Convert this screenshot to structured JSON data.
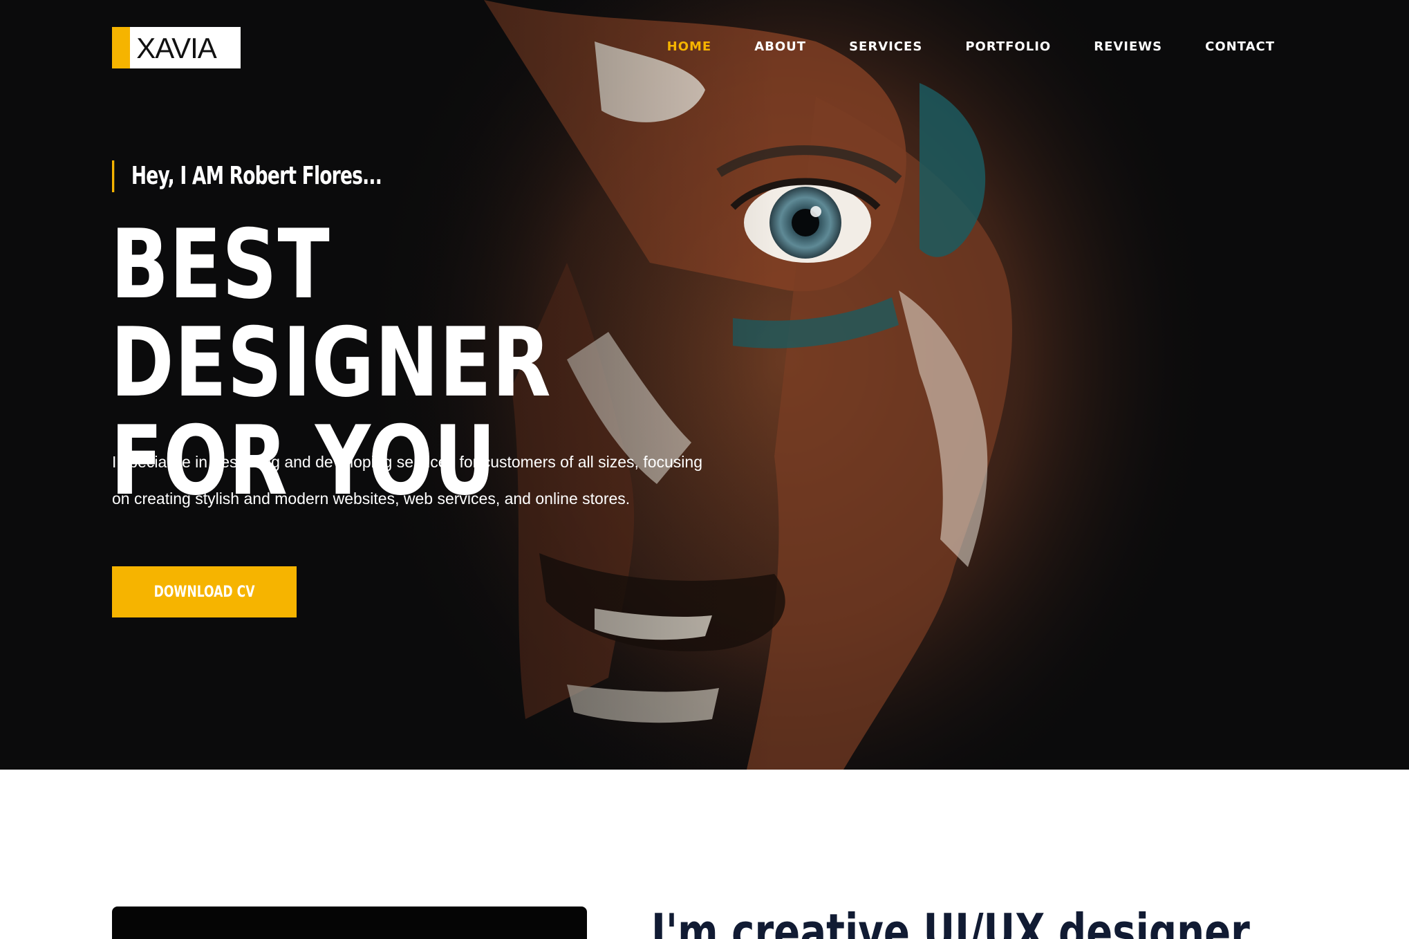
{
  "brand": {
    "logo_text": "XAVIA",
    "accent_color": "#f6b400"
  },
  "nav": {
    "items": [
      {
        "label": "HOME",
        "active": true
      },
      {
        "label": "ABOUT",
        "active": false
      },
      {
        "label": "SERVICES",
        "active": false
      },
      {
        "label": "PORTFOLIO",
        "active": false
      },
      {
        "label": "REVIEWS",
        "active": false
      },
      {
        "label": "CONTACT",
        "active": false
      }
    ]
  },
  "hero": {
    "intro": "Hey, I AM Robert Flores...",
    "headline_line1": "BEST DESIGNER",
    "headline_line2": "FOR YOU",
    "description_line1": "I specialize in designing and developing services for customers of all sizes, focusing",
    "description_line2": "on creating stylish and modern websites, web services, and online stores.",
    "cta_label": "DOWNLOAD CV",
    "background_image": "painted-face-portrait"
  },
  "about": {
    "title": "I'm creative UI/UX designer"
  }
}
